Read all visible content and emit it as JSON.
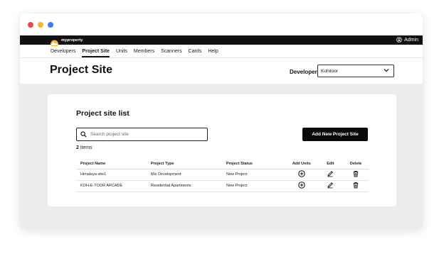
{
  "window": {
    "controls": [
      "close",
      "minimize",
      "maximize"
    ]
  },
  "topbar": {
    "logo_text": "myproperty",
    "logo_badge": "",
    "user_label": "Admin",
    "user_icon": "user-circle-icon"
  },
  "nav": {
    "items": [
      "Developers",
      "Project Site",
      "Units",
      "Members",
      "Scanners",
      "Cards",
      "Help"
    ],
    "active": "Project Site"
  },
  "header": {
    "title": "Project Site",
    "developer_label": "Developer",
    "developer_value": "Kohitoor"
  },
  "card": {
    "title": "Project site list",
    "search_placeholder": "Search project site",
    "add_button": "Add New Project Site",
    "count_number": "2",
    "count_suffix": " items"
  },
  "table": {
    "headers": [
      "Project Name",
      "Project Type",
      "Project Status",
      "Add Units",
      "Edit",
      "Delete"
    ],
    "rows": [
      {
        "name": "Himalaya site1",
        "type": "Mix Development",
        "status": "New Project"
      },
      {
        "name": "KOH-E-TOOR ARCADE",
        "type": "Residential Apartments",
        "status": "New Project"
      }
    ]
  },
  "colors": {
    "accent_yellow": "#f5b731",
    "topbar": "#111111",
    "button": "#0a0a0a",
    "background": "#ececec"
  }
}
